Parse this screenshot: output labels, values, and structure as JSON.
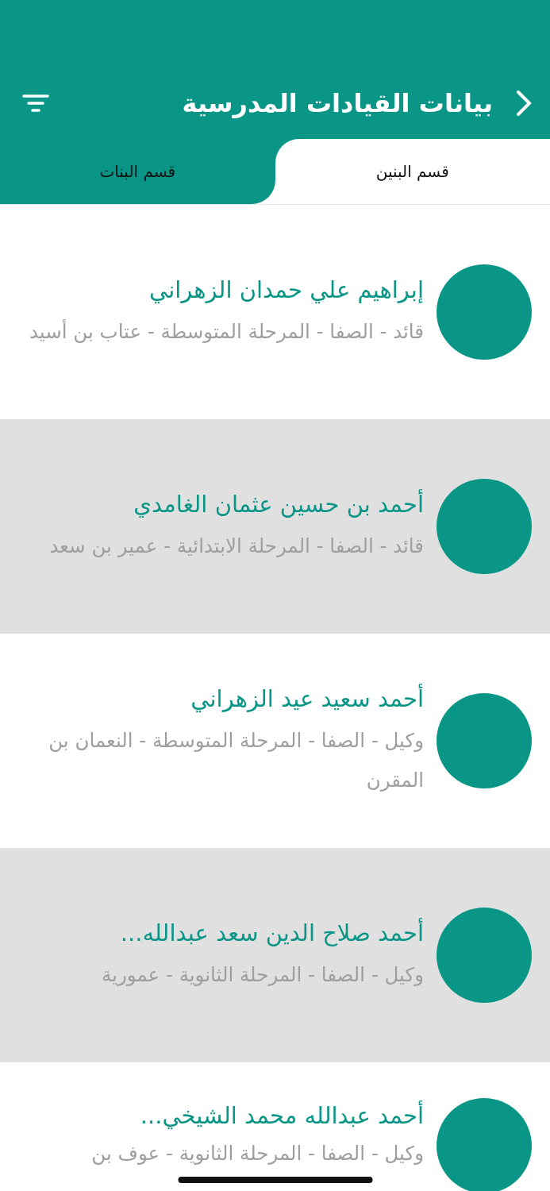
{
  "header": {
    "title": "بيانات القيادات المدرسية"
  },
  "tabs": [
    {
      "label": "قسم البنين",
      "selected": true
    },
    {
      "label": "قسم البنات",
      "selected": false
    }
  ],
  "people": [
    {
      "name": "إبراهيم علي حمدان الزهراني",
      "details": "قائد - الصفا - المرحلة المتوسطة - عتاب بن أسيد"
    },
    {
      "name": "أحمد بن حسين عثمان الغامدي",
      "details": "قائد - الصفا - المرحلة الابتدائية - عمير بن سعد"
    },
    {
      "name": "أحمد سعيد عيد الزهراني",
      "details": "وكيل - الصفا - المرحلة المتوسطة - النعمان بن المقرن"
    },
    {
      "name": "أحمد صلاح الدين سعد عبدالله...",
      "details": "وكيل - الصفا - المرحلة الثانوية - عمورية"
    },
    {
      "name": "أحمد عبدالله محمد الشيخي...",
      "details": "وكيل - الصفا - المرحلة الثانوية - عوف بن"
    }
  ]
}
